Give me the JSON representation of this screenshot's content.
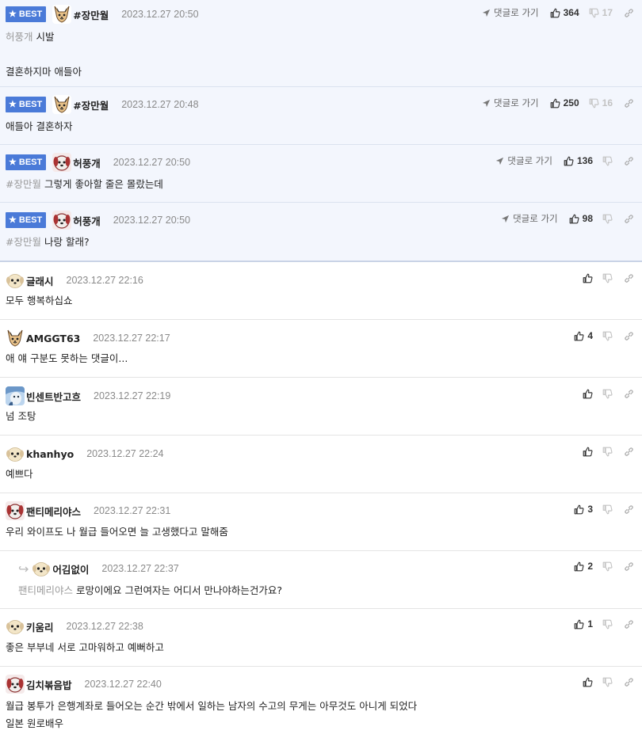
{
  "best_badge": "BEST",
  "goto_label": "댓글로 가기",
  "comments": [
    {
      "nick": "#장만월",
      "date": "2023.12.27 20:50",
      "likes": "364",
      "dislikes": "17",
      "mention": "허풍개",
      "lines": [
        "시발",
        "",
        "결혼하지마 애들아"
      ],
      "avatar": "fox-avatar"
    },
    {
      "nick": "#장만월",
      "date": "2023.12.27 20:48",
      "likes": "250",
      "dislikes": "16",
      "mention": "",
      "lines": [
        "애들아 결혼하자"
      ],
      "avatar": "fox-avatar"
    },
    {
      "nick": "허풍개",
      "date": "2023.12.27 20:50",
      "likes": "136",
      "dislikes": "",
      "mention": "#장만월",
      "lines": [
        "그렇게 좋아할 줄은 몰랐는데"
      ],
      "avatar": "dog-avatar"
    },
    {
      "nick": "허풍개",
      "date": "2023.12.27 20:50",
      "likes": "98",
      "dislikes": "",
      "mention": "#장만월",
      "lines": [
        "나랑 할래?"
      ],
      "avatar": "dog-avatar"
    },
    {
      "nick": "글래시",
      "date": "2023.12.27 22:16",
      "likes": "",
      "dislikes": "",
      "mention": "",
      "lines": [
        "모두 행복하십쇼"
      ],
      "avatar": "puppy-avatar"
    },
    {
      "nick": "AMGGT63",
      "date": "2023.12.27 22:17",
      "likes": "4",
      "dislikes": "",
      "mention": "",
      "lines": [
        "애 얘 구분도 못하는 댓글이..."
      ],
      "avatar": "fox-avatar"
    },
    {
      "nick": "빈센트반고흐",
      "date": "2023.12.27 22:19",
      "likes": "",
      "dislikes": "",
      "mention": "",
      "lines": [
        "넘 조탕"
      ],
      "avatar": "sky-avatar"
    },
    {
      "nick": "khanhyo",
      "date": "2023.12.27 22:24",
      "likes": "",
      "dislikes": "",
      "mention": "",
      "lines": [
        "예쁘다"
      ],
      "avatar": "puppy-avatar"
    },
    {
      "nick": "팬티메리야스",
      "date": "2023.12.27 22:31",
      "likes": "3",
      "dislikes": "",
      "mention": "",
      "lines": [
        "우리 와이프도 나 월급 들어오면 늘 고생했다고 말해줌"
      ],
      "avatar": "dog-avatar"
    },
    {
      "nick": "어김없이",
      "date": "2023.12.27 22:37",
      "likes": "2",
      "dislikes": "",
      "mention": "팬티메리야스",
      "lines": [
        "로망이에요 그런여자는 어디서 만나야하는건가요?"
      ],
      "avatar": "puppy-avatar"
    },
    {
      "nick": "키움리",
      "date": "2023.12.27 22:38",
      "likes": "1",
      "dislikes": "",
      "mention": "",
      "lines": [
        "좋은 부부네 서로 고마워하고 예뻐하고"
      ],
      "avatar": "puppy-avatar"
    },
    {
      "nick": "김치볶음밥",
      "date": "2023.12.27 22:40",
      "likes": "",
      "dislikes": "",
      "mention": "",
      "lines": [
        "월급 봉투가 은행계좌로 들어오는 순간 밖에서 일하는 남자의 수고의 무게는 아무것도 아니게 되었다",
        "일본 원로배우"
      ],
      "avatar": "dog-avatar"
    }
  ],
  "colors": {
    "best_bg": "#f3f6fd",
    "badge": "#4a7ad8",
    "mention": "#9a9a9a"
  }
}
